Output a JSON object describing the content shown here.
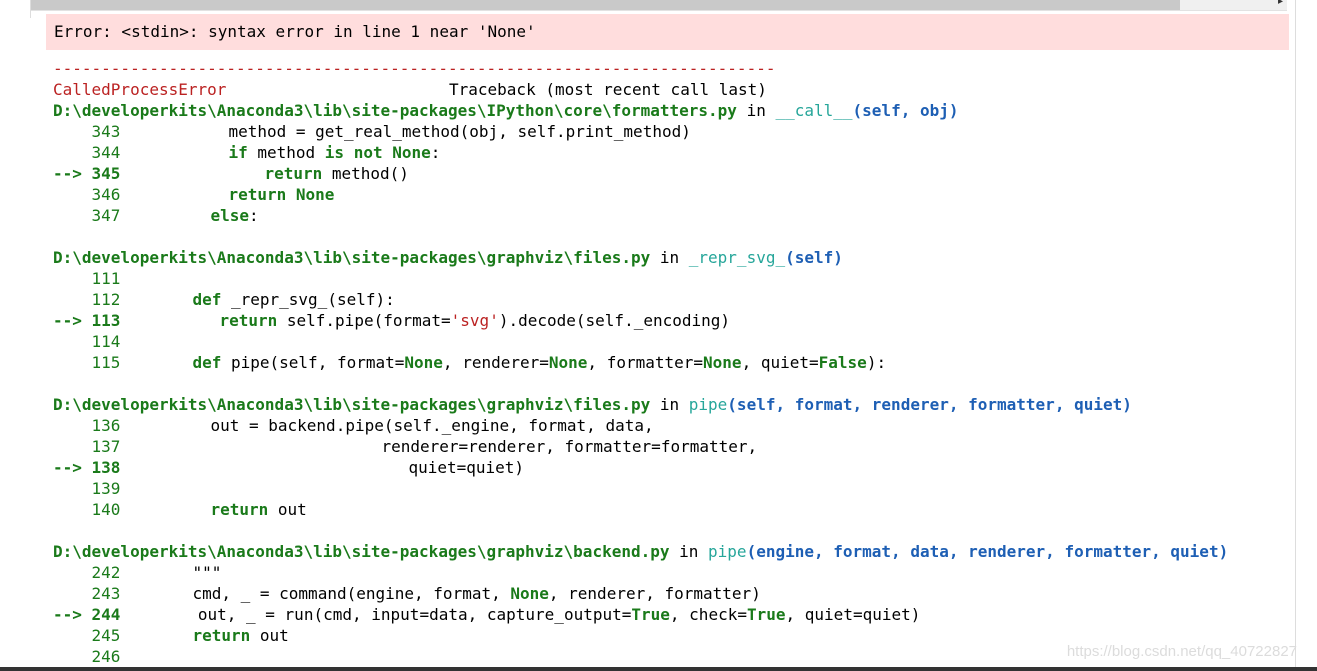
{
  "error_message": "Error: <stdin>: syntax error in line 1 near 'None'",
  "separator": "---------------------------------------------------------------------------",
  "exception": {
    "name": "CalledProcessError",
    "header": "Traceback (most recent call last)"
  },
  "frames": [
    {
      "path": "D:\\developerkits\\Anaconda3\\lib\\site-packages\\IPython\\core\\formatters.py",
      "in_word": "in",
      "func": "__call__",
      "args": "(self, obj)",
      "lines": [
        {
          "num": "343",
          "code": "method = get_real_method(obj, self.print_method)",
          "arrow": false
        },
        {
          "num": "344",
          "code": "if method is not None:",
          "arrow": false
        },
        {
          "num": "345",
          "code": "return method()",
          "arrow": true
        },
        {
          "num": "346",
          "code": "return None",
          "arrow": false
        },
        {
          "num": "347",
          "code": "else:",
          "arrow": false
        }
      ]
    },
    {
      "path": "D:\\developerkits\\Anaconda3\\lib\\site-packages\\graphviz\\files.py",
      "in_word": "in",
      "func": "_repr_svg_",
      "args": "(self)",
      "lines": [
        {
          "num": "111",
          "code": "",
          "arrow": false
        },
        {
          "num": "112",
          "code": "def _repr_svg_(self):",
          "arrow": false
        },
        {
          "num": "113",
          "code": "return self.pipe(format='svg').decode(self._encoding)",
          "arrow": true
        },
        {
          "num": "114",
          "code": "",
          "arrow": false
        },
        {
          "num": "115",
          "code": "def pipe(self, format=None, renderer=None, formatter=None, quiet=False):",
          "arrow": false
        }
      ]
    },
    {
      "path": "D:\\developerkits\\Anaconda3\\lib\\site-packages\\graphviz\\files.py",
      "in_word": "in",
      "func": "pipe",
      "args": "(self, format, renderer, formatter, quiet)",
      "lines": [
        {
          "num": "136",
          "code": "out = backend.pipe(self._engine, format, data,",
          "arrow": false
        },
        {
          "num": "137",
          "code": "renderer=renderer, formatter=formatter,",
          "arrow": false
        },
        {
          "num": "138",
          "code": "quiet=quiet)",
          "arrow": true
        },
        {
          "num": "139",
          "code": "",
          "arrow": false
        },
        {
          "num": "140",
          "code": "return out",
          "arrow": false
        }
      ]
    },
    {
      "path": "D:\\developerkits\\Anaconda3\\lib\\site-packages\\graphviz\\backend.py",
      "in_word": "in",
      "func": "pipe",
      "args": "(engine, format, data, renderer, formatter, quiet)",
      "lines": [
        {
          "num": "242",
          "code": "\"\"\"",
          "arrow": false
        },
        {
          "num": "243",
          "code": "cmd, _ = command(engine, format, None, renderer, formatter)",
          "arrow": false
        },
        {
          "num": "244",
          "code": "out, _ = run(cmd, input=data, capture_output=True, check=True, quiet=quiet)",
          "arrow": true
        },
        {
          "num": "245",
          "code": "return out",
          "arrow": false
        },
        {
          "num": "246",
          "code": "",
          "arrow": false
        }
      ]
    }
  ],
  "arrow_marker": "-->",
  "watermark": "https://blog.csdn.net/qq_40722827"
}
